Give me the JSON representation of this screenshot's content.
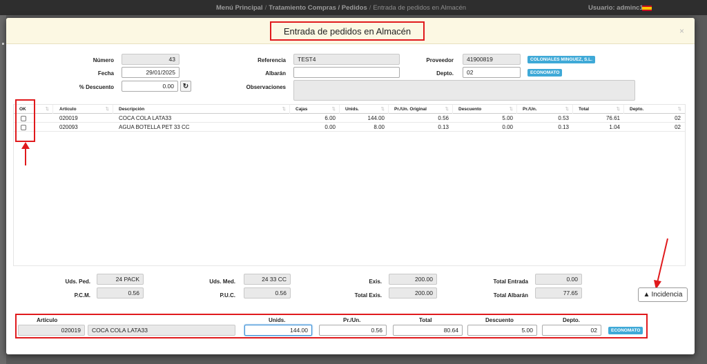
{
  "topbar": {
    "breadcrumb": [
      "Menú Principal",
      "Tratamiento Compras / Pedidos",
      "Entrada de pedidos en Almacén"
    ],
    "user": "Usuario: adminc1"
  },
  "modal": {
    "title": "Entrada de pedidos en Almacén",
    "close": "×"
  },
  "header_form": {
    "numero_label": "Número",
    "numero_value": "43",
    "fecha_label": "Fecha",
    "fecha_value": "29/01/2025",
    "descuento_label": "% Descuento",
    "descuento_value": "0.00",
    "referencia_label": "Referencia",
    "referencia_value": "TEST4",
    "albaran_label": "Albarán",
    "albaran_value": "",
    "observaciones_label": "Observaciones",
    "observaciones_value": "",
    "proveedor_label": "Proveedor",
    "proveedor_value": "41900819",
    "proveedor_badge": "COLONIALES MINGUEZ, S.L.",
    "depto_label": "Depto.",
    "depto_value": "02",
    "depto_badge": "ECONOMATO"
  },
  "grid": {
    "columns": [
      "OK",
      "Artículo",
      "Descripción",
      "Cajas",
      "Unids.",
      "Pr./Un. Original",
      "Descuento",
      "Pr./Un.",
      "Total",
      "Depto."
    ],
    "rows": [
      {
        "articulo": "020019",
        "descripcion": "COCA COLA LATA33",
        "cajas": "6.00",
        "unids": "144.00",
        "pr_original": "0.56",
        "descuento": "5.00",
        "pr_un": "0.53",
        "total": "76.61",
        "depto": "02"
      },
      {
        "articulo": "020093",
        "descripcion": "AGUA BOTELLA PET 33 CC",
        "cajas": "0.00",
        "unids": "8.00",
        "pr_original": "0.13",
        "descuento": "0.00",
        "pr_un": "0.13",
        "total": "1.04",
        "depto": "02"
      }
    ]
  },
  "summary": {
    "uds_ped_label": "Uds. Ped.",
    "uds_ped_value": "24 PACK",
    "pcm_label": "P.C.M.",
    "pcm_value": "0.56",
    "uds_med_label": "Uds. Med.",
    "uds_med_value": "24 33 CC",
    "puc_label": "P.U.C.",
    "puc_value": "0.56",
    "exis_label": "Exis.",
    "exis_value": "200.00",
    "total_exis_label": "Total Exis.",
    "total_exis_value": "200.00",
    "total_entrada_label": "Total Entrada",
    "total_entrada_value": "0.00",
    "total_albaran_label": "Total Albarán",
    "total_albaran_value": "77.65",
    "incidencia_label": "Incidencia"
  },
  "entry": {
    "articulo_label": "Artículo",
    "articulo_code": "020019",
    "articulo_desc": "COCA COLA LATA33",
    "unids_label": "Unids.",
    "unids_value": "144.00",
    "prun_label": "Pr./Un.",
    "prun_value": "0.56",
    "total_label": "Total",
    "total_value": "80.64",
    "descuento_label": "Descuento",
    "descuento_value": "5.00",
    "depto_label": "Depto.",
    "depto_value": "02",
    "depto_badge": "ECONOMATO"
  },
  "colors": {
    "accent": "#3fa9d7",
    "highlight": "#e0191c",
    "header_bg": "#fcf8e3"
  }
}
